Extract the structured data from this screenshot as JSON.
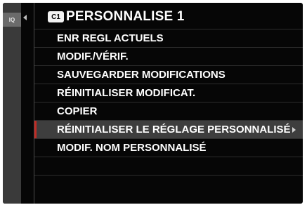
{
  "side_tab": {
    "label": "IQ"
  },
  "header": {
    "badge": "C1",
    "title": "PERSONNALISE 1"
  },
  "menu": {
    "items": [
      {
        "label": "ENR REGL ACTUELS",
        "selected": false
      },
      {
        "label": "MODIF./VÉRIF.",
        "selected": false
      },
      {
        "label": "SAUVEGARDER MODIFICATIONS",
        "selected": false
      },
      {
        "label": "RÉINITIALISER MODIFICAT.",
        "selected": false
      },
      {
        "label": "COPIER",
        "selected": false
      },
      {
        "label": "RÉINITIALISER LE RÉGLAGE PERSONNALISÉ",
        "selected": true
      },
      {
        "label": "MODIF. NOM PERSONNALISÉ",
        "selected": false
      }
    ]
  },
  "colors": {
    "background": "#060606",
    "selected_row": "#3e3e3e",
    "selection_marker": "#c22b24",
    "text": "#ffffff"
  }
}
